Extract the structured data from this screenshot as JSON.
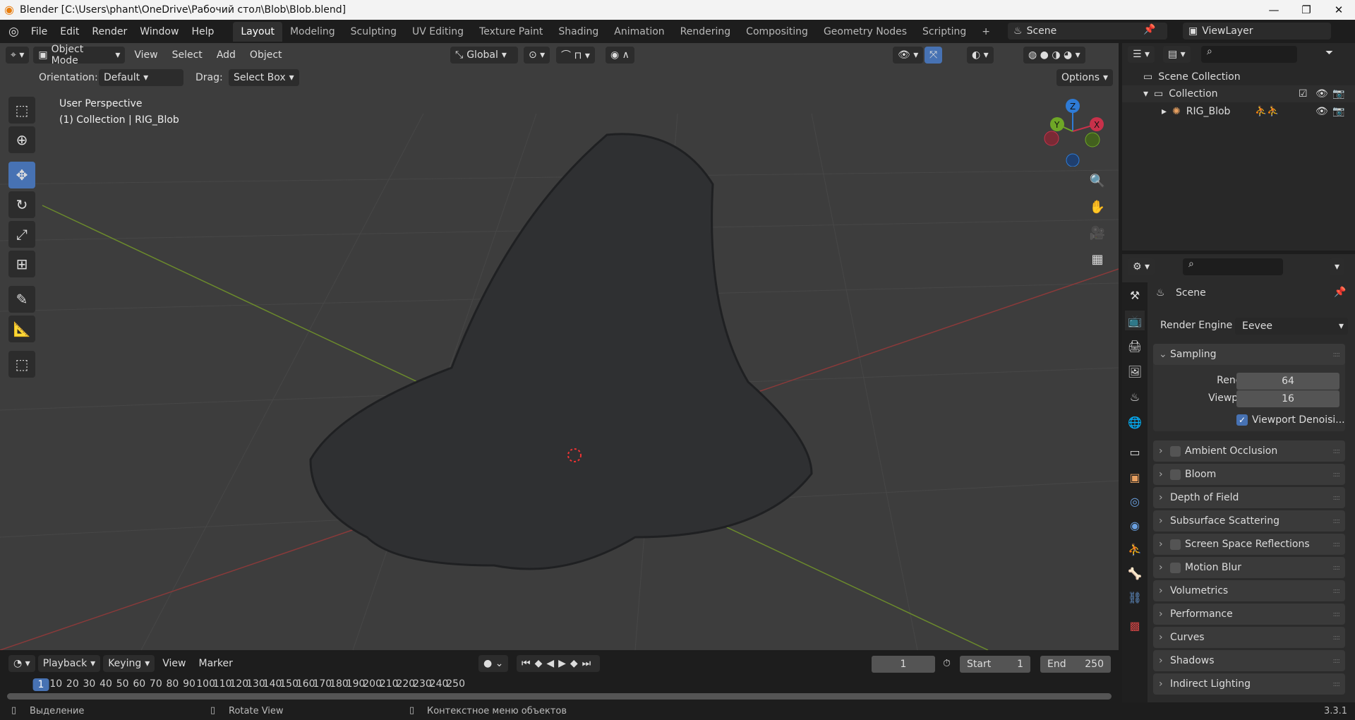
{
  "window": {
    "title": "Blender [C:\\Users\\phant\\OneDrive\\Рабочий стол\\Blob\\Blob.blend]",
    "minimize": "—",
    "maximize": "❐",
    "close": "✕"
  },
  "menu": [
    "File",
    "Edit",
    "Render",
    "Window",
    "Help"
  ],
  "workspaces": [
    "Layout",
    "Modeling",
    "Sculpting",
    "UV Editing",
    "Texture Paint",
    "Shading",
    "Animation",
    "Rendering",
    "Compositing",
    "Geometry Nodes",
    "Scripting",
    "+"
  ],
  "scene": {
    "name": "Scene",
    "view_layer": "ViewLayer"
  },
  "viewport_header": {
    "mode": "Object Mode",
    "menus": [
      "View",
      "Select",
      "Add",
      "Object"
    ],
    "transform": "Global",
    "options": "Options"
  },
  "tool_settings": {
    "orientation_label": "Orientation:",
    "orientation": "Default",
    "drag_label": "Drag:",
    "drag": "Select Box"
  },
  "overlay_text": {
    "perspective": "User Perspective",
    "object": "(1) Collection | RIG_Blob"
  },
  "gizmo": {
    "z": "Z",
    "y": "Y",
    "x": "X"
  },
  "outliner": {
    "root": "Scene Collection",
    "collection": "Collection",
    "object": "RIG_Blob"
  },
  "properties": {
    "context": "Scene",
    "render_engine_label": "Render Engine",
    "render_engine": "Eevee",
    "sampling": {
      "title": "Sampling",
      "render_label": "Render",
      "render": "64",
      "viewport_label": "Viewport",
      "viewport": "16",
      "denoise": "Viewport Denoisi..."
    },
    "panels": [
      {
        "label": "Ambient Occlusion",
        "checkbox": true
      },
      {
        "label": "Bloom",
        "checkbox": true
      },
      {
        "label": "Depth of Field",
        "checkbox": false
      },
      {
        "label": "Subsurface Scattering",
        "checkbox": false
      },
      {
        "label": "Screen Space Reflections",
        "checkbox": true
      },
      {
        "label": "Motion Blur",
        "checkbox": true
      },
      {
        "label": "Volumetrics",
        "checkbox": false
      },
      {
        "label": "Performance",
        "checkbox": false
      },
      {
        "label": "Curves",
        "checkbox": false
      },
      {
        "label": "Shadows",
        "checkbox": false
      },
      {
        "label": "Indirect Lighting",
        "checkbox": false
      }
    ]
  },
  "timeline": {
    "menus": [
      "Playback",
      "Keying",
      "View",
      "Marker"
    ],
    "current_frame": "1",
    "start_label": "Start",
    "start": "1",
    "end_label": "End",
    "end": "250",
    "ticks": [
      "1",
      "10",
      "20",
      "30",
      "40",
      "50",
      "60",
      "70",
      "80",
      "90",
      "100",
      "110",
      "120",
      "130",
      "140",
      "150",
      "160",
      "170",
      "180",
      "190",
      "200",
      "210",
      "220",
      "230",
      "240",
      "250"
    ]
  },
  "status": {
    "left": "Выделение",
    "middle": "Rotate View",
    "right": "Контекстное меню объектов",
    "version": "3.3.1"
  }
}
